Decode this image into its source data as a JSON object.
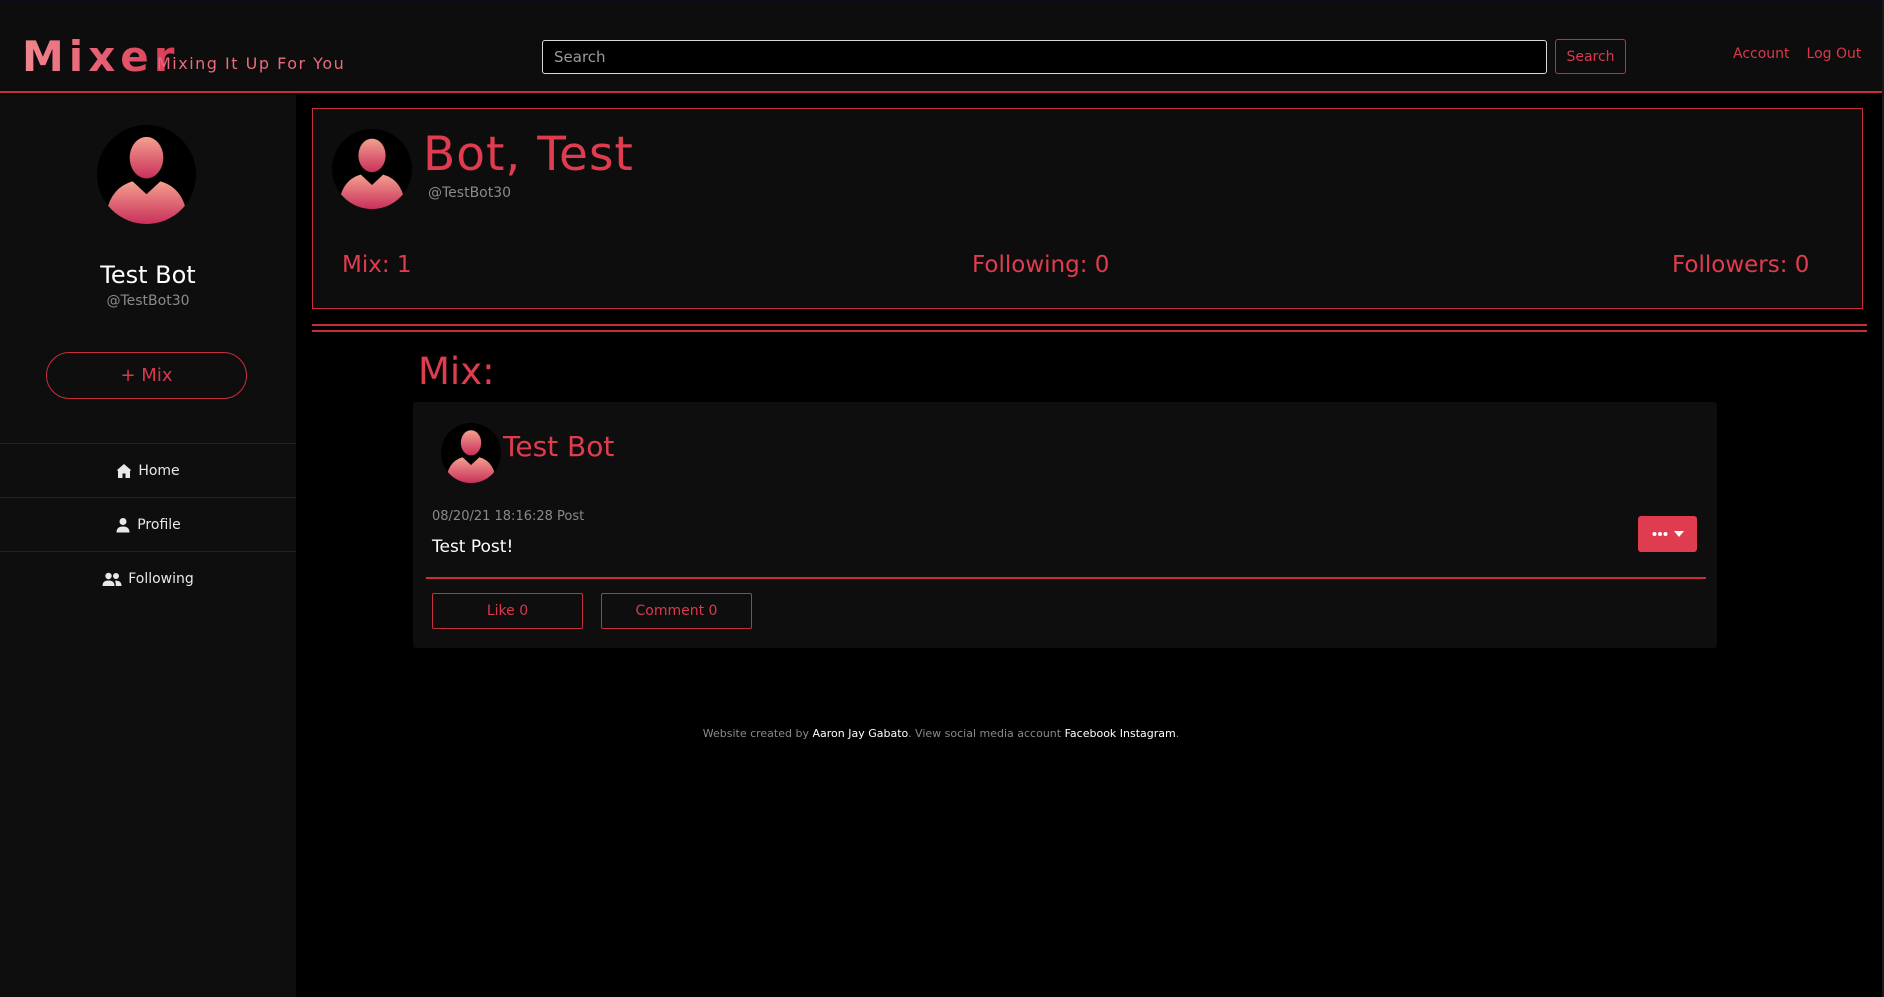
{
  "app": {
    "brand": "Mixer",
    "tagline": "Mixing It Up For You"
  },
  "search": {
    "placeholder": "Search",
    "button_label": "Search"
  },
  "nav": {
    "account": "Account",
    "logout": "Log Out"
  },
  "sidebar": {
    "name": "Test Bot",
    "handle": "@TestBot30",
    "mix_button": "+ Mix",
    "items": [
      {
        "label": "Home",
        "icon": "home-icon"
      },
      {
        "label": "Profile",
        "icon": "user-icon"
      },
      {
        "label": "Following",
        "icon": "users-icon"
      }
    ]
  },
  "profile": {
    "title": "Bot, Test",
    "handle": "@TestBot30",
    "stats": {
      "mix": "Mix: 1",
      "following": "Following: 0",
      "followers": "Followers: 0"
    }
  },
  "mix": {
    "heading": "Mix:",
    "posts": [
      {
        "author": "Test Bot",
        "meta": "08/20/21 18:16:28 Post",
        "body": "Test Post!",
        "like_label": "Like 0",
        "comment_label": "Comment 0"
      }
    ]
  },
  "footer": {
    "prefix": "Website created by",
    "author": "Aaron Jay Gabato",
    "middle": ". View social media account",
    "facebook": "Facebook",
    "instagram": "Instagram",
    "suffix": "."
  },
  "colors": {
    "accent": "#e03c4f",
    "border": "#c62e3e",
    "background": "#000000",
    "panel": "#0e0e0e"
  }
}
